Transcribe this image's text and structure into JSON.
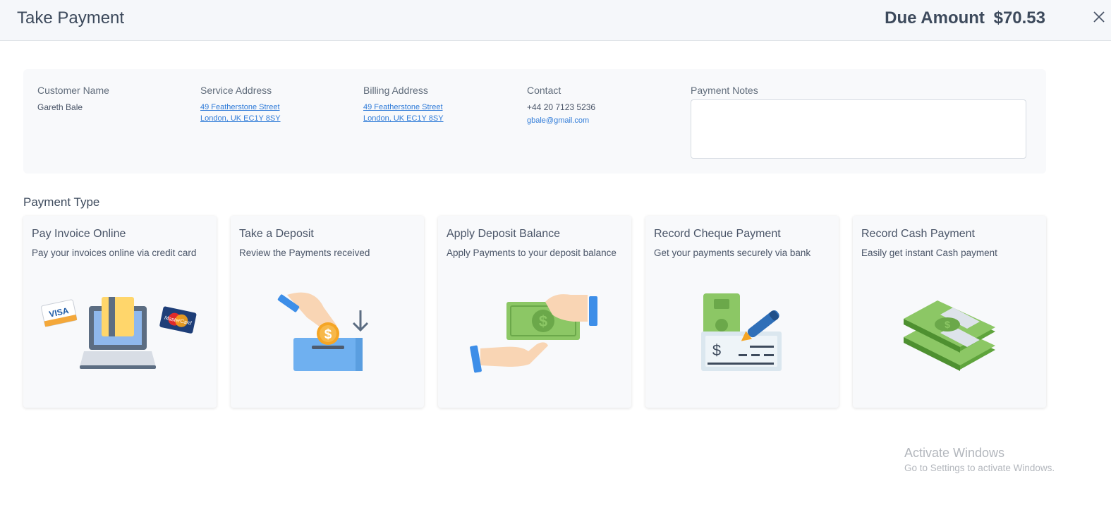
{
  "header": {
    "title": "Take Payment",
    "due_label": "Due Amount",
    "due_amount": "$70.53"
  },
  "customer": {
    "name_label": "Customer Name",
    "name": "Gareth Bale",
    "service_label": "Service Address",
    "service_line1": "49 Featherstone Street",
    "service_line2": "London, UK EC1Y 8SY",
    "billing_label": "Billing Address",
    "billing_line1": "49 Featherstone Street",
    "billing_line2": "London, UK EC1Y 8SY",
    "contact_label": "Contact",
    "phone": "+44 20 7123 5236",
    "email": "gbale@gmail.com",
    "notes_label": "Payment Notes",
    "notes_value": ""
  },
  "payment_type": {
    "title": "Payment Type",
    "cards": [
      {
        "title": "Pay Invoice Online",
        "desc": "Pay your invoices online via credit card",
        "icon": "credit-card-laptop-icon",
        "visa": "VISA",
        "mastercard": "MasterCard"
      },
      {
        "title": "Take a Deposit",
        "desc": "Review the Payments received",
        "icon": "deposit-icon",
        "symbol": "$"
      },
      {
        "title": "Apply Deposit Balance",
        "desc": "Apply Payments to your deposit balance",
        "icon": "money-handover-icon",
        "symbol": "$"
      },
      {
        "title": "Record Cheque Payment",
        "desc": "Get your payments securely via bank",
        "icon": "cheque-icon",
        "symbol": "$"
      },
      {
        "title": "Record Cash Payment",
        "desc": "Easily get instant Cash payment",
        "icon": "cash-stack-icon",
        "symbol": "$"
      }
    ]
  },
  "watermark": {
    "title": "Activate Windows",
    "subtitle": "Go to Settings to activate Windows."
  },
  "colors": {
    "header_bg": "#f5f7fa",
    "panel_bg": "#f8f9fb",
    "link": "#2f7bd8",
    "money_green": "#8cc765",
    "accent_blue": "#3d8ee8",
    "heading": "#3d4a5c"
  }
}
